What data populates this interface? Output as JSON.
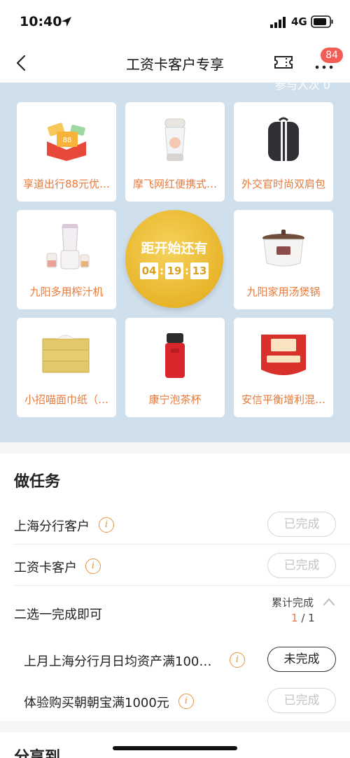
{
  "status_bar": {
    "time": "10:40",
    "network": "4G"
  },
  "nav": {
    "title": "工资卡客户专享",
    "badge": "84"
  },
  "lottery": {
    "hint": "参与人次 0",
    "center_text": "距开始还有",
    "countdown": {
      "hours": "04",
      "minutes": "19",
      "seconds": "13"
    },
    "prizes": [
      {
        "label": "享道出行88元优…",
        "icon": "coupon-icon"
      },
      {
        "label": "摩飞网红便携式…",
        "icon": "blender-cup-icon"
      },
      {
        "label": "外交官时尚双肩包",
        "icon": "backpack-icon"
      },
      {
        "label": "九阳多用榨汁机",
        "icon": "juicer-icon"
      },
      {
        "label": "九阳家用汤煲锅",
        "icon": "slow-cooker-icon"
      },
      {
        "label": "小招喵面巾纸（…",
        "icon": "tissue-box-icon"
      },
      {
        "label": "康宁泡茶杯",
        "icon": "tea-cup-icon"
      },
      {
        "label": "安信平衡增利混…",
        "icon": "fund-card-icon"
      }
    ]
  },
  "tasks": {
    "heading": "做任务",
    "items": [
      {
        "label": "上海分行客户",
        "status": "已完成"
      },
      {
        "label": "工资卡客户",
        "status": "已完成"
      }
    ],
    "group": {
      "label": "二选一完成即可",
      "summary_label": "累计完成",
      "summary_current": "1",
      "summary_total": " / 1"
    },
    "sub_items": [
      {
        "label": "上月上海分行月日均资产满100…",
        "status": "未完成"
      },
      {
        "label": "体验购买朝朝宝满1000元",
        "status": "已完成"
      }
    ]
  },
  "share": {
    "title": "分享到"
  },
  "colors": {
    "accent": "#e77a3a",
    "badge": "#f25c54",
    "lottery_bg": "#cfdfeb",
    "gold": "#e8b52a"
  }
}
